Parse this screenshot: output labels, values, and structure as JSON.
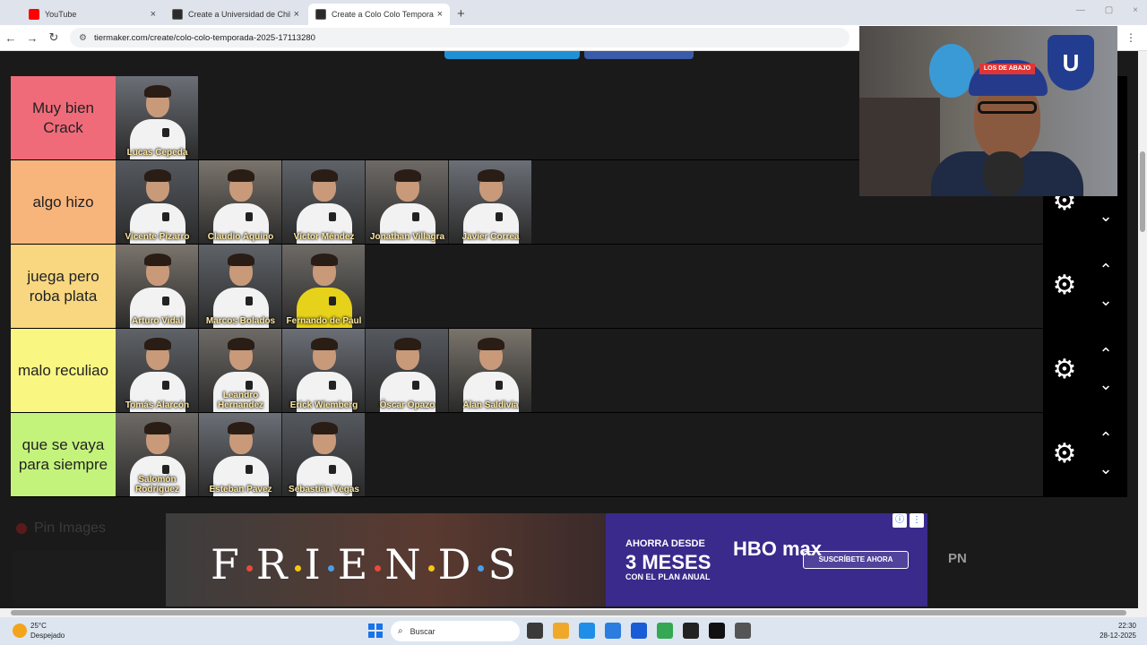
{
  "browser": {
    "tabs": [
      {
        "label": "YouTube",
        "favicon": "youtube-icon",
        "active": false
      },
      {
        "label": "Create a Universidad de Chile T",
        "favicon": "tiermaker-icon",
        "active": false
      },
      {
        "label": "Create a Colo Colo Temporada",
        "favicon": "tiermaker-icon",
        "active": true
      }
    ],
    "new_tab": "+",
    "url": "tiermaker.com/create/colo-colo-temporada-2025-17113280",
    "back": "←",
    "forward": "→",
    "reload": "↻",
    "menu": "⋮",
    "close": "×",
    "minimize": "—",
    "maximize": "▢"
  },
  "tiers": [
    {
      "label": "Muy bien Crack",
      "color": "#f06b79",
      "players": [
        {
          "name": "Lucas Cepeda",
          "kit": "white"
        }
      ]
    },
    {
      "label": "algo hizo",
      "color": "#f7b57c",
      "players": [
        {
          "name": "Vicente Pizarro",
          "kit": "white"
        },
        {
          "name": "Claudio Aquino",
          "kit": "white"
        },
        {
          "name": "Víctor Méndez",
          "kit": "white"
        },
        {
          "name": "Jonathan Villagra",
          "kit": "white"
        },
        {
          "name": "Javier Correa",
          "kit": "white"
        }
      ]
    },
    {
      "label": "juega pero roba plata",
      "color": "#f8d780",
      "players": [
        {
          "name": "Arturo Vidal",
          "kit": "white"
        },
        {
          "name": "Marcos Bolados",
          "kit": "white"
        },
        {
          "name": "Fernando de Paul",
          "kit": "yellow"
        }
      ]
    },
    {
      "label": "malo reculiao",
      "color": "#f9f682",
      "players": [
        {
          "name": "Tomás Alarcón",
          "kit": "white"
        },
        {
          "name": "Leandro Hernandez",
          "kit": "white"
        },
        {
          "name": "Erick Wiemberg",
          "kit": "white"
        },
        {
          "name": "Óscar Opazo",
          "kit": "white"
        },
        {
          "name": "Alan Saldivia",
          "kit": "white"
        }
      ]
    },
    {
      "label": "que se vaya para siempre",
      "color": "#c4f37c",
      "players": [
        {
          "name": "Salomón Rodríguez",
          "kit": "white"
        },
        {
          "name": "Esteban Pavez",
          "kit": "white"
        },
        {
          "name": "Sebastián Vegas",
          "kit": "white"
        }
      ]
    }
  ],
  "tier_controls": {
    "gear": "⚙",
    "up": "⌃",
    "down": "⌄"
  },
  "webcam": {
    "cap_text": "LOS DE ABAJO",
    "logo_text": "U"
  },
  "pin_images": {
    "label": "Pin Images"
  },
  "ad": {
    "friends_letters": [
      "F",
      "R",
      "I",
      "E",
      "N",
      "D",
      "S"
    ],
    "friends_dot_colors": [
      "#e84a3a",
      "#f5c518",
      "#4a9ee8",
      "#e84a3a",
      "#f5c518",
      "#4a9ee8"
    ],
    "ahorra": "AHORRA DESDE",
    "meses": "3 MESES",
    "plan": "CON EL PLAN ANUAL",
    "brand": "HBO max",
    "cta": "SUSCRÍBETE AHORA",
    "info": "ⓘ",
    "more": "⋮",
    "side_text": "PN"
  },
  "taskbar": {
    "temperature": "25°C",
    "weather": "Despejado",
    "search_placeholder": "Buscar",
    "time": "22:30",
    "date": "28-12-2025",
    "app_icon_colors": [
      "#3a3a3a",
      "#f0a82a",
      "#1f8ee8",
      "#2b7de0",
      "#1a5bd6",
      "#34a853",
      "#222",
      "#111",
      "#555"
    ]
  }
}
